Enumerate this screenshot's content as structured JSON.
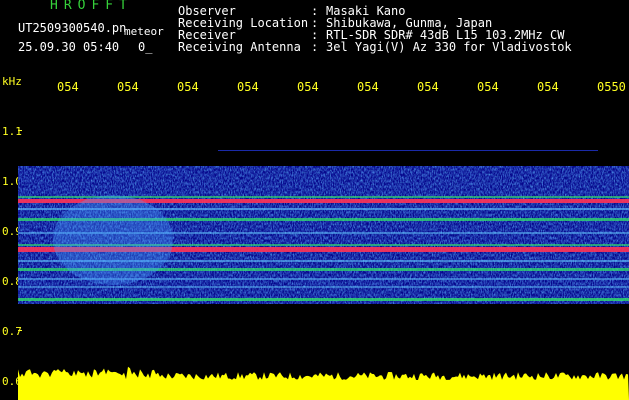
{
  "program": {
    "title": "HROFFT"
  },
  "file": {
    "name": "UT2509300540.pn",
    "suffix": "meteor",
    "timestamp": "25.09.30 05:40",
    "count": "0_"
  },
  "header": {
    "rows": [
      {
        "label": "Observer",
        "value": "Masaki Kano"
      },
      {
        "label": "Receiving Location",
        "value": "Shibukawa, Gunma, Japan"
      },
      {
        "label": "Receiver",
        "value": "RTL-SDR SDR# 43dB L15 103.2MHz CW"
      },
      {
        "label": "Receiving Antenna",
        "value": "3el Yagi(V) Az 330 for Vladivostok"
      }
    ],
    "separator": ":"
  },
  "axis": {
    "unit": "kHz",
    "time_ticks": [
      "054",
      "054",
      "054",
      "054",
      "054",
      "054",
      "054",
      "054",
      "054",
      "0550"
    ],
    "freq_ticks": [
      "1.1",
      "1.0",
      "0.9",
      "0.8",
      "0.7",
      "0.6"
    ]
  },
  "colors": {
    "background": "#000000",
    "program_title": "#35d13a",
    "labels": "#ffff22",
    "noise_floor": "#05058a",
    "signal_strong": "#ff3355",
    "signal_mid": "#33ee66",
    "power_trace": "#ffff00"
  }
}
